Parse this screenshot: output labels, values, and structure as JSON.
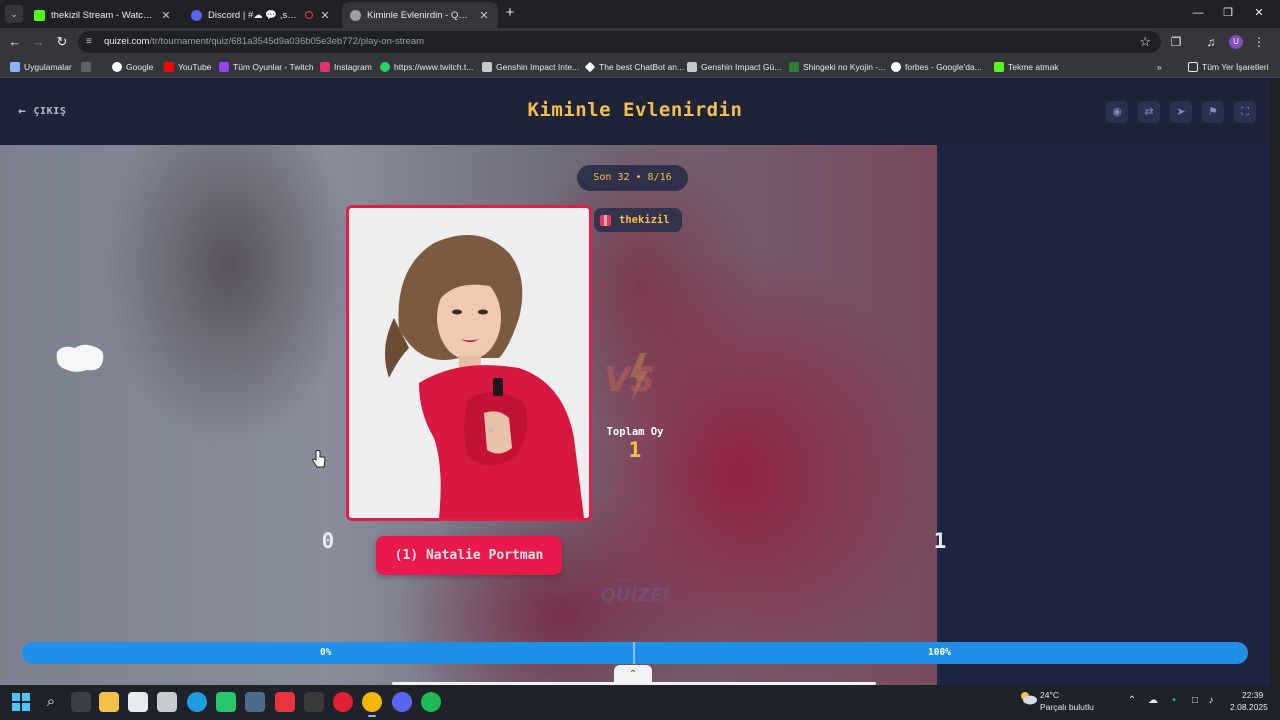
{
  "browser": {
    "tabs": [
      {
        "title": "thekizil Stream - Watch Live on",
        "active": false,
        "favicon_color": "#53fc18"
      },
      {
        "title": "Discord | #☁ 💬 ,sohbet | Th",
        "active": false,
        "favicon_color": "#5865f2"
      },
      {
        "title": "Kiminle Evlenirdin - Quizei",
        "active": true,
        "favicon_color": "#9aa0a6"
      }
    ],
    "url_domain": "quizei.com",
    "url_path": "/tr/tournament/quiz/681a3545d9a036b05e3eb772/play-on-stream",
    "profile_initial": "U",
    "bookmarks": [
      {
        "label": "Uygulamalar",
        "color": "#8ab4f8"
      },
      {
        "label": "Google",
        "color": "#ffffff"
      },
      {
        "label": "YouTube",
        "color": "#ff0000"
      },
      {
        "label": "Tüm Oyunlar - Twitch",
        "color": "#9146ff"
      },
      {
        "label": "Instagram",
        "color": "#e1306c"
      },
      {
        "label": "https://www.twitch.t...",
        "color": "#25d366"
      },
      {
        "label": "Genshin Impact Inte...",
        "color": "#c9c9c9"
      },
      {
        "label": "The best ChatBot an...",
        "color": "#ffffff"
      },
      {
        "label": "Genshin Impact Gü...",
        "color": "#c9c9c9"
      },
      {
        "label": "Shingeki no Kyojin -...",
        "color": "#2e7d32"
      },
      {
        "label": "forbes - Google'da...",
        "color": "#ffffff"
      },
      {
        "label": "Tekme atmak",
        "color": "#53fc18"
      }
    ],
    "all_bookmarks": "Tüm Yer İşaretleri"
  },
  "page": {
    "exit_label": "ÇIKIŞ",
    "title": "Kiminle Evlenirdin",
    "round": "Son 32 • 8/16",
    "streamer": "thekizil",
    "contestant": "(1) Natalie Portman",
    "total_votes_label": "Toplam Oy",
    "total_votes": "1",
    "watermark_small": "made with",
    "watermark_brand": "QUIZEI",
    "score_left": "0",
    "score_right": "1",
    "percent_left": "0%",
    "percent_right": "100%",
    "left_share": 0.0,
    "colors": {
      "accent": "#f4c04a",
      "primary": "#e8194b",
      "bar": "#1f8fe8"
    }
  },
  "taskbar": {
    "temperature": "24°C",
    "weather": "Parçalı bulutlu",
    "time": "22:39",
    "date": "2.08.2025"
  }
}
